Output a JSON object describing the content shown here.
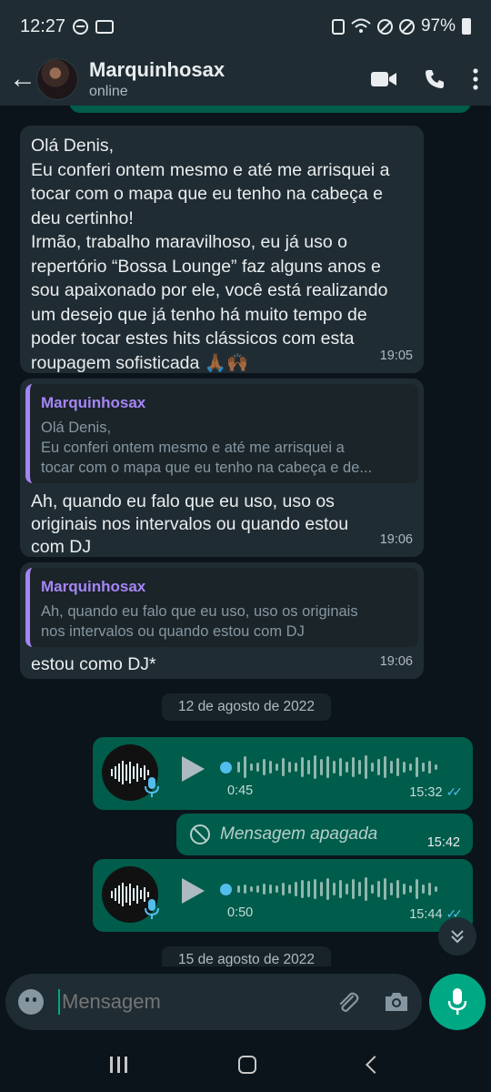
{
  "status_bar": {
    "time": "12:27",
    "battery": "97%"
  },
  "header": {
    "contact_name": "Marquinhosax",
    "contact_status": "online"
  },
  "messages": [
    {
      "text": "Olá Denis,\nEu conferi ontem mesmo e até me arrisquei a tocar com o mapa que eu tenho na cabeça e deu certinho!\nIrmão, trabalho maravilhoso, eu já uso o repertório “Bossa Lounge” faz alguns anos e sou apaixonado por ele, você está realizando um desejo que já tenho há muito tempo de poder tocar estes hits clássicos com esta roupagem sofisticada 🙏🏾🙌🏾",
      "time": "19:05"
    },
    {
      "quote_name": "Marquinhosax",
      "quote_text": "Olá Denis,\nEu conferi ontem mesmo e até me arrisquei a\ntocar com o mapa que eu tenho na cabeça e de...",
      "text": "Ah, quando eu falo que eu uso, uso os originais nos intervalos ou quando estou com DJ",
      "time": "19:06"
    },
    {
      "quote_name": "Marquinhosax",
      "quote_text": "Ah, quando eu falo que eu uso, uso os originais\nnos intervalos ou quando estou com DJ",
      "text": "estou como DJ*",
      "time": "19:06"
    }
  ],
  "date_1": "12 de agosto de 2022",
  "voice_1": {
    "duration": "0:45",
    "time": "15:32",
    "checks": "✓✓"
  },
  "deleted": {
    "text": "Mensagem apagada",
    "time": "15:42"
  },
  "voice_2": {
    "duration": "0:50",
    "time": "15:44",
    "checks": "✓✓"
  },
  "date_2": "15 de agosto de 2022",
  "input": {
    "placeholder": "Mensagem"
  },
  "colors": {
    "accent": "#00a884",
    "outgoing": "#005c4b",
    "incoming": "#202c33",
    "quote_name": "#a685f6",
    "read_checks": "#53bdeb"
  }
}
